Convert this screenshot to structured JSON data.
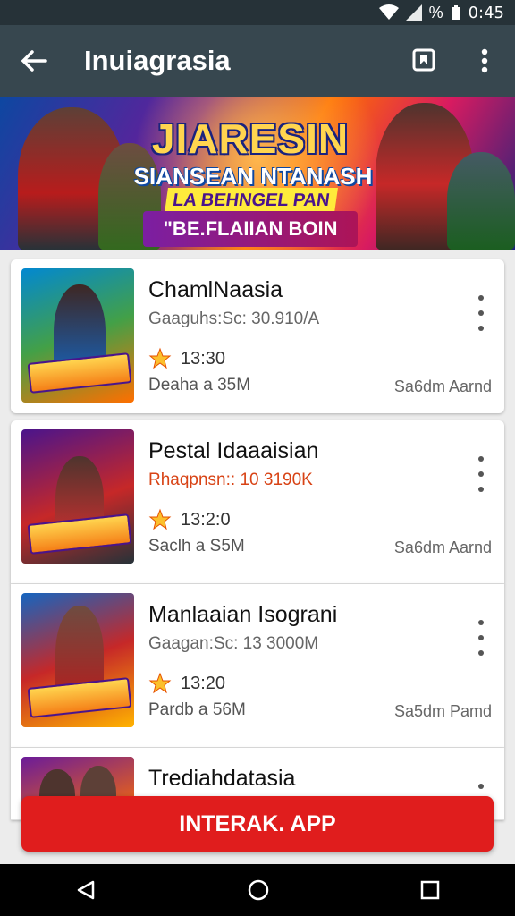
{
  "status_bar": {
    "percent": "%",
    "time": "0:45"
  },
  "app_bar": {
    "title": "Inuiagrasia"
  },
  "banner": {
    "headline": "JIARESIN",
    "subline": "SIANSEAN NTANASH",
    "tagline": "LA BEHNGEL PAN",
    "pill": "\"BE.FLAIIAN BOIN"
  },
  "games": [
    {
      "name": "ChamlNaasia",
      "sub": "Gaaguhs:Sc: 30.910/A",
      "rating": "13:30",
      "size": "Deaha a 35M",
      "right": "Sa6dm Aarnd"
    },
    {
      "name": "Pestal Idaaaisian",
      "sub": "Rhaqpnsn:: 10 3190K",
      "rating": "13:2:0",
      "size": "Saclh a S5M",
      "right": "Sa6dm Aarnd"
    },
    {
      "name": "Manlaaian Isograni",
      "sub": "Gaagan:Sc: 13 3000M",
      "rating": "13:20",
      "size": "Pardb a 56M",
      "right": "Sa5dm Pamd"
    },
    {
      "name": "Trediahdatasia",
      "sub": "",
      "rating": "",
      "size": "",
      "right": ""
    }
  ],
  "cta": {
    "label": "INTERAK. APP"
  },
  "colors": {
    "app_bar": "#37474f",
    "status_bar": "#263238",
    "cta": "#e01d1d",
    "accent_red": "#d84315",
    "star": "#fbc02d"
  },
  "icons": [
    "back-arrow-icon",
    "bookmark-icon",
    "more-vertical-icon",
    "star-icon",
    "nav-back-icon",
    "nav-home-icon",
    "nav-recents-icon"
  ]
}
